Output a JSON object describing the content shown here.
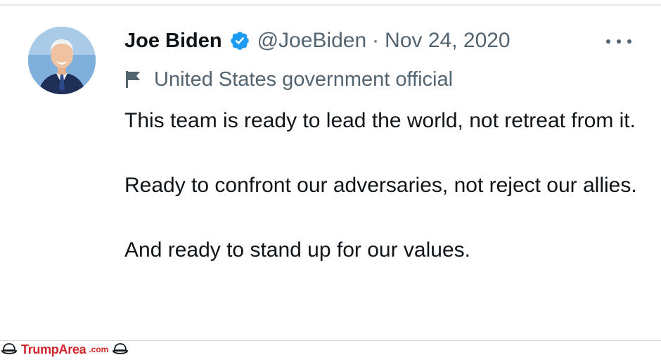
{
  "tweet": {
    "author_name": "Joe Biden",
    "handle": "@JoeBiden",
    "separator": "·",
    "date": "Nov 24, 2020",
    "label": "United States government official",
    "paragraphs": [
      "This team is ready to lead the world, not retreat from it.",
      "Ready to confront our adversaries, not reject our allies.",
      "And ready to stand up for our values."
    ]
  },
  "icons": {
    "verified": "verified-badge-icon",
    "label": "flag-icon",
    "more": "more-options-icon"
  },
  "colors": {
    "verified_blue": "#1d9bf0",
    "secondary_text": "#536471",
    "primary_text": "#0f1419",
    "watermark_red": "#d1262b"
  },
  "watermark": {
    "brand": "TrumpArea",
    "suffix": ".com"
  }
}
